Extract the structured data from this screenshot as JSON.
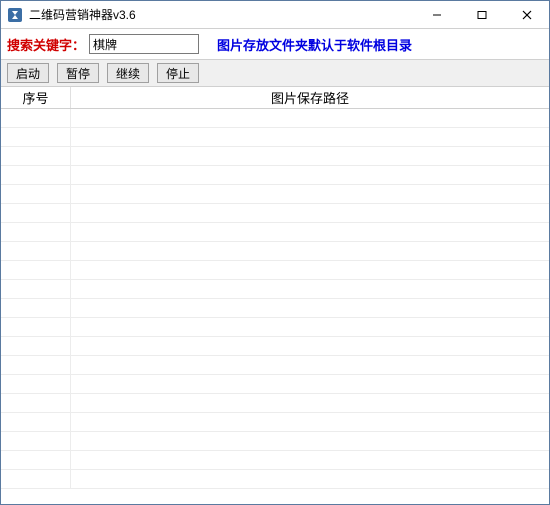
{
  "titlebar": {
    "title": "二维码营销神器v3.6"
  },
  "search": {
    "label": "搜索关键字：",
    "value": "棋牌",
    "note": "图片存放文件夹默认于软件根目录"
  },
  "toolbar": {
    "start": "启动",
    "pause": "暂停",
    "resume": "继续",
    "stop": "停止"
  },
  "table": {
    "headers": {
      "index": "序号",
      "path": "图片保存路径"
    },
    "rows": [
      {},
      {},
      {},
      {},
      {},
      {},
      {},
      {},
      {},
      {},
      {},
      {},
      {},
      {},
      {},
      {},
      {},
      {},
      {},
      {}
    ]
  }
}
